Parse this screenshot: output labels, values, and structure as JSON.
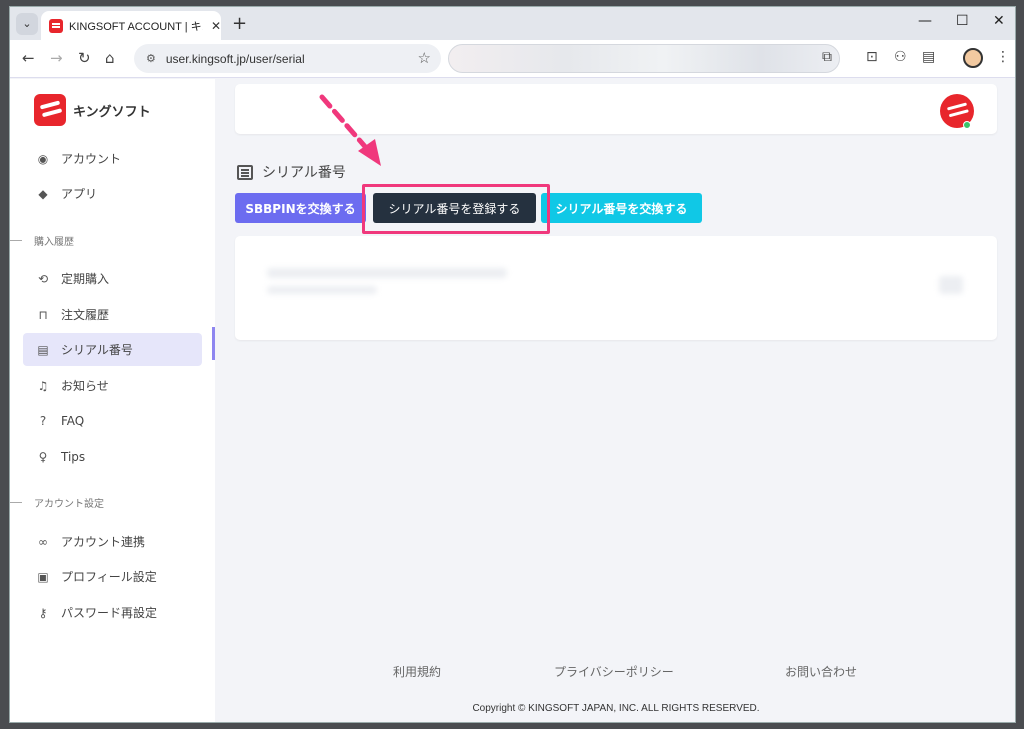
{
  "browser": {
    "tab_title": "KINGSOFT ACCOUNT | キングソフ",
    "tab_close": "✕",
    "new_tab": "+",
    "minimize": "—",
    "maximize": "☐",
    "close": "✕",
    "url": "user.kingsoft.jp/user/serial"
  },
  "sidebar": {
    "brand": "キングソフト",
    "items_top": [
      {
        "label": "アカウント",
        "icon": "account-circle-icon"
      },
      {
        "label": "アプリ",
        "icon": "apps-icon"
      }
    ],
    "section_purchase": "購入履歴",
    "items_purchase": [
      {
        "label": "定期購入",
        "icon": "refresh-icon"
      },
      {
        "label": "注文履歴",
        "icon": "shopping-bag-icon"
      },
      {
        "label": "シリアル番号",
        "icon": "document-icon",
        "active": true
      },
      {
        "label": "お知らせ",
        "icon": "bell-icon"
      },
      {
        "label": "FAQ",
        "icon": "question-icon"
      },
      {
        "label": "Tips",
        "icon": "lightbulb-icon"
      }
    ],
    "section_account": "アカウント設定",
    "items_account": [
      {
        "label": "アカウント連携",
        "icon": "link-icon"
      },
      {
        "label": "プロフィール設定",
        "icon": "profile-icon"
      },
      {
        "label": "パスワード再設定",
        "icon": "key-icon"
      }
    ]
  },
  "main": {
    "heading": "シリアル番号",
    "buttons": {
      "sbbpin": "SBBPINを交換する",
      "register": "シリアル番号を登録する",
      "exchange": "シリアル番号を交換する"
    },
    "footer": {
      "terms": "利用規約",
      "privacy": "プライバシーポリシー",
      "contact": "お問い合わせ",
      "copyright": "Copyright © KINGSOFT JAPAN, INC. ALL RIGHTS RESERVED."
    }
  },
  "colors": {
    "brand_red": "#e8262c",
    "sbbpin_button": "#6c6cf0",
    "register_button": "#25313f",
    "exchange_button": "#10c8e6",
    "annotation_pink": "#f0387c",
    "active_nav_bg": "#e6e6fa"
  }
}
